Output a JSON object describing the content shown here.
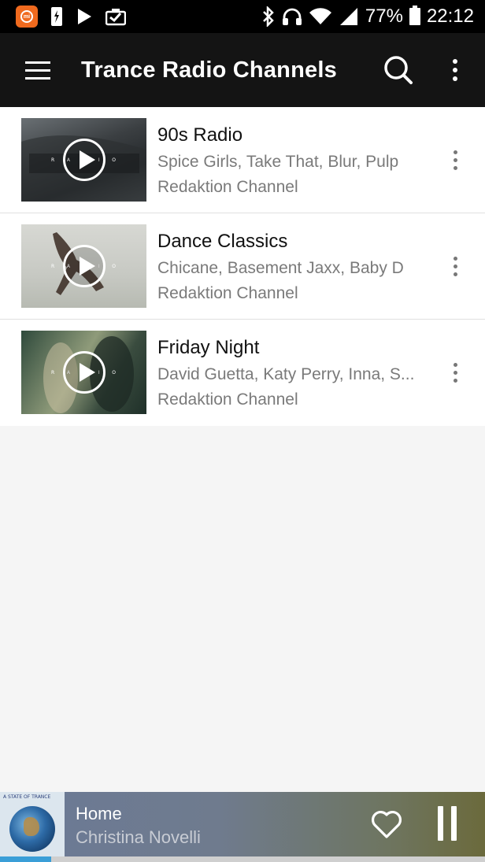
{
  "status_bar": {
    "battery": "77%",
    "time": "22:12",
    "icons": [
      "mi-icon",
      "sim-icon",
      "play-store-icon",
      "clipboard-check-icon",
      "bluetooth-icon",
      "headphones-icon",
      "wifi-icon",
      "signal-icon",
      "battery-icon"
    ]
  },
  "app_bar": {
    "title": "Trance Radio Channels",
    "icons": [
      "menu-icon",
      "search-icon",
      "more-vert-icon"
    ]
  },
  "channels": [
    {
      "title": "90s Radio",
      "artists": "Spice Girls, Take That, Blur, Pulp",
      "source": "Redaktion Channel"
    },
    {
      "title": "Dance Classics",
      "artists": "Chicane, Basement Jaxx, Baby D",
      "source": "Redaktion Channel"
    },
    {
      "title": "Friday Night",
      "artists": "David Guetta, Katy Perry, Inna, S...",
      "source": "Redaktion Channel"
    }
  ],
  "thumb_letters": [
    "R",
    "A",
    "D",
    "I",
    "O"
  ],
  "player": {
    "title": "Home",
    "artist": "Christina Novelli",
    "thumb_brand": "A STATE OF TRANCE",
    "progress_fraction": 0.105
  },
  "colors": {
    "app_bar": "#141414",
    "accent_progress": "#3a9ed7",
    "mi_orange": "#f06a1e"
  }
}
